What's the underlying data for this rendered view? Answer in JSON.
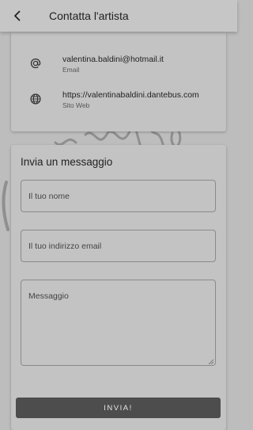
{
  "appbar": {
    "title": "Contatta l'artista",
    "back_icon": "arrow-left-icon"
  },
  "contact": {
    "email": {
      "value": "valentina.baldini@hotmail.it",
      "label": "Email",
      "icon": "at-sign-icon"
    },
    "website": {
      "value": "https://valentinabaldini.dantebus.com",
      "label": "Sito Web",
      "icon": "globe-icon"
    }
  },
  "message_form": {
    "title": "Invia un messaggio",
    "name_placeholder": "Il tuo nome",
    "email_placeholder": "Il tuo indirizzo email",
    "message_placeholder": "Messaggio",
    "submit_label": "INVIA!"
  },
  "colors": {
    "overlay_background": "#bdbdbd",
    "card_background": "#c3c3c3",
    "button_background": "#4d4d4d",
    "button_text": "#e6e6e6"
  }
}
